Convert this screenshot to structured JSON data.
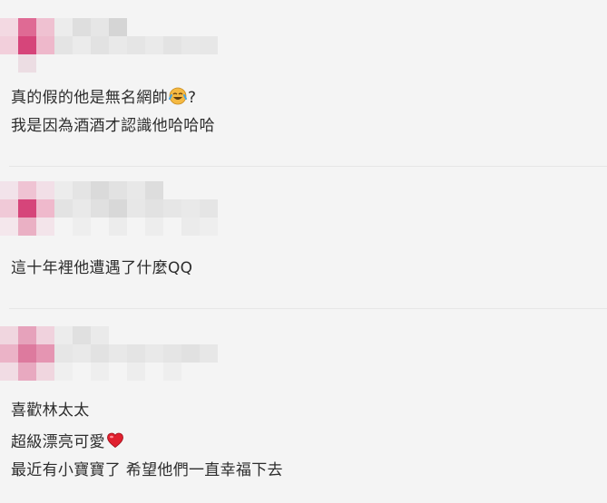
{
  "comments": [
    {
      "lines": [
        "真的假的他是無名網帥",
        "?",
        "我是因為酒酒才認識他哈哈哈"
      ],
      "emoji": "laughing-crying-emoji"
    },
    {
      "lines": [
        "這十年裡他遭遇了什麼QQ"
      ]
    },
    {
      "lines": [
        "喜歡林太太",
        "超級漂亮可愛",
        "最近有小寶寶了 希望他們一直幸福下去"
      ],
      "emoji": "red-heart-emoji"
    }
  ],
  "colors": {
    "background": "#f4f4f4",
    "divider": "#e6e6e6",
    "avatar_pink": "#d6457a",
    "heart": "#e0202e",
    "emoji_yellow": "#f5b942"
  }
}
